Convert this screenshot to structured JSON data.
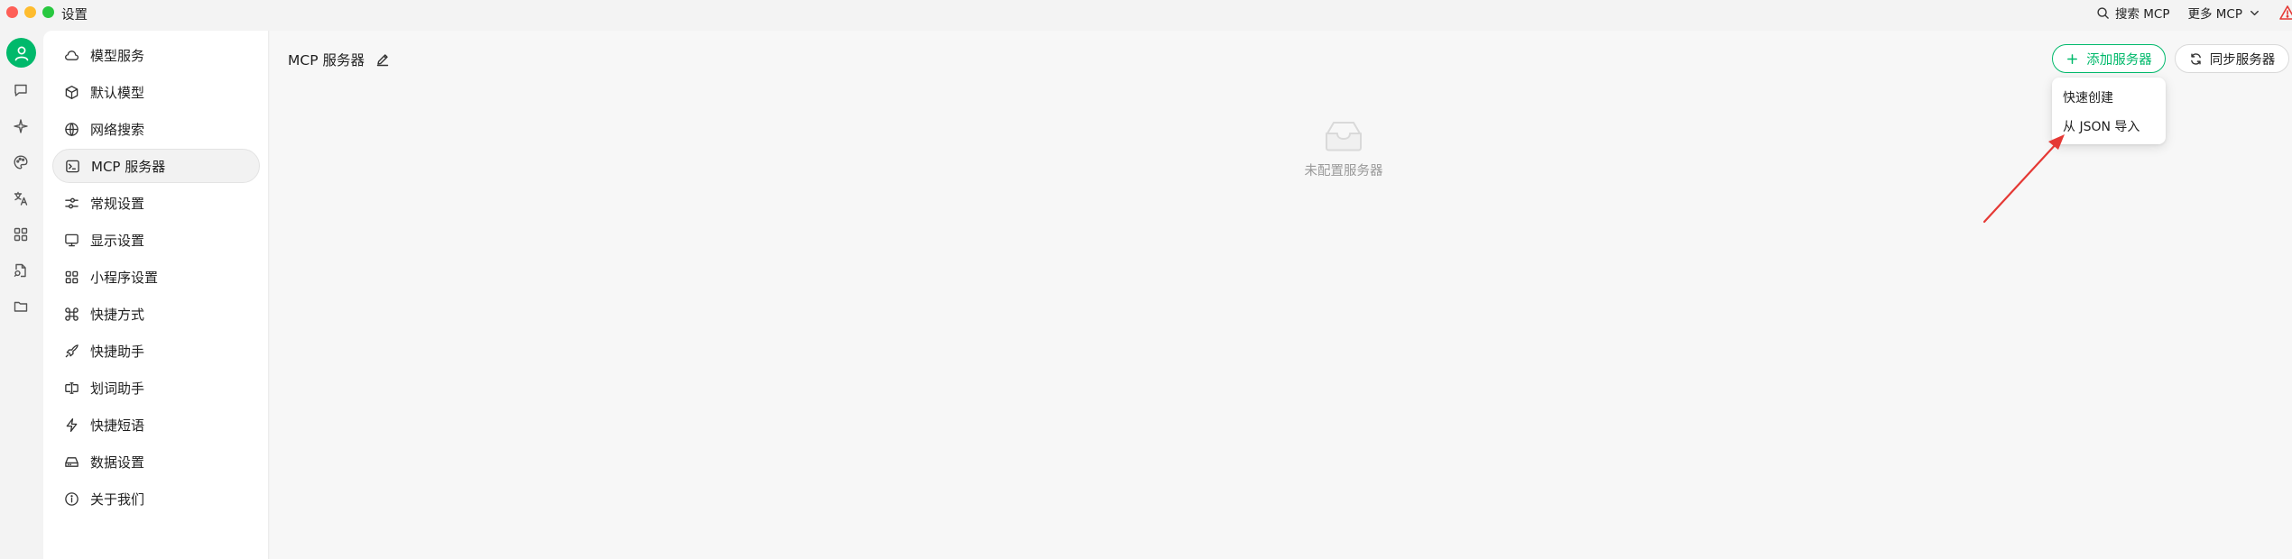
{
  "window": {
    "title": "设置",
    "search_mcp_label": "搜索 MCP",
    "more_mcp_label": "更多 MCP"
  },
  "rail": {
    "icons": [
      "chat-icon",
      "sparkle-icon",
      "palette-icon",
      "translate-icon",
      "apps-grid-icon",
      "file-search-icon",
      "folder-icon"
    ]
  },
  "nav": {
    "items": [
      {
        "label": "模型服务",
        "icon": "cloud-icon"
      },
      {
        "label": "默认模型",
        "icon": "cube-icon"
      },
      {
        "label": "网络搜索",
        "icon": "globe-icon"
      },
      {
        "label": "MCP 服务器",
        "icon": "terminal-icon",
        "active": true
      },
      {
        "label": "常规设置",
        "icon": "sliders-icon"
      },
      {
        "label": "显示设置",
        "icon": "monitor-icon"
      },
      {
        "label": "小程序设置",
        "icon": "grid-icon"
      },
      {
        "label": "快捷方式",
        "icon": "command-icon"
      },
      {
        "label": "快捷助手",
        "icon": "rocket-icon"
      },
      {
        "label": "划词助手",
        "icon": "text-cursor-icon"
      },
      {
        "label": "快捷短语",
        "icon": "zap-icon"
      },
      {
        "label": "数据设置",
        "icon": "hard-drive-icon"
      },
      {
        "label": "关于我们",
        "icon": "info-icon"
      }
    ]
  },
  "main": {
    "title": "MCP 服务器",
    "add_button": "添加服务器",
    "sync_button": "同步服务器",
    "dropdown": [
      "快速创建",
      "从 JSON 导入"
    ],
    "empty_text": "未配置服务器"
  },
  "colors": {
    "accent": "#00b96b",
    "annotation_arrow": "#e53935"
  }
}
